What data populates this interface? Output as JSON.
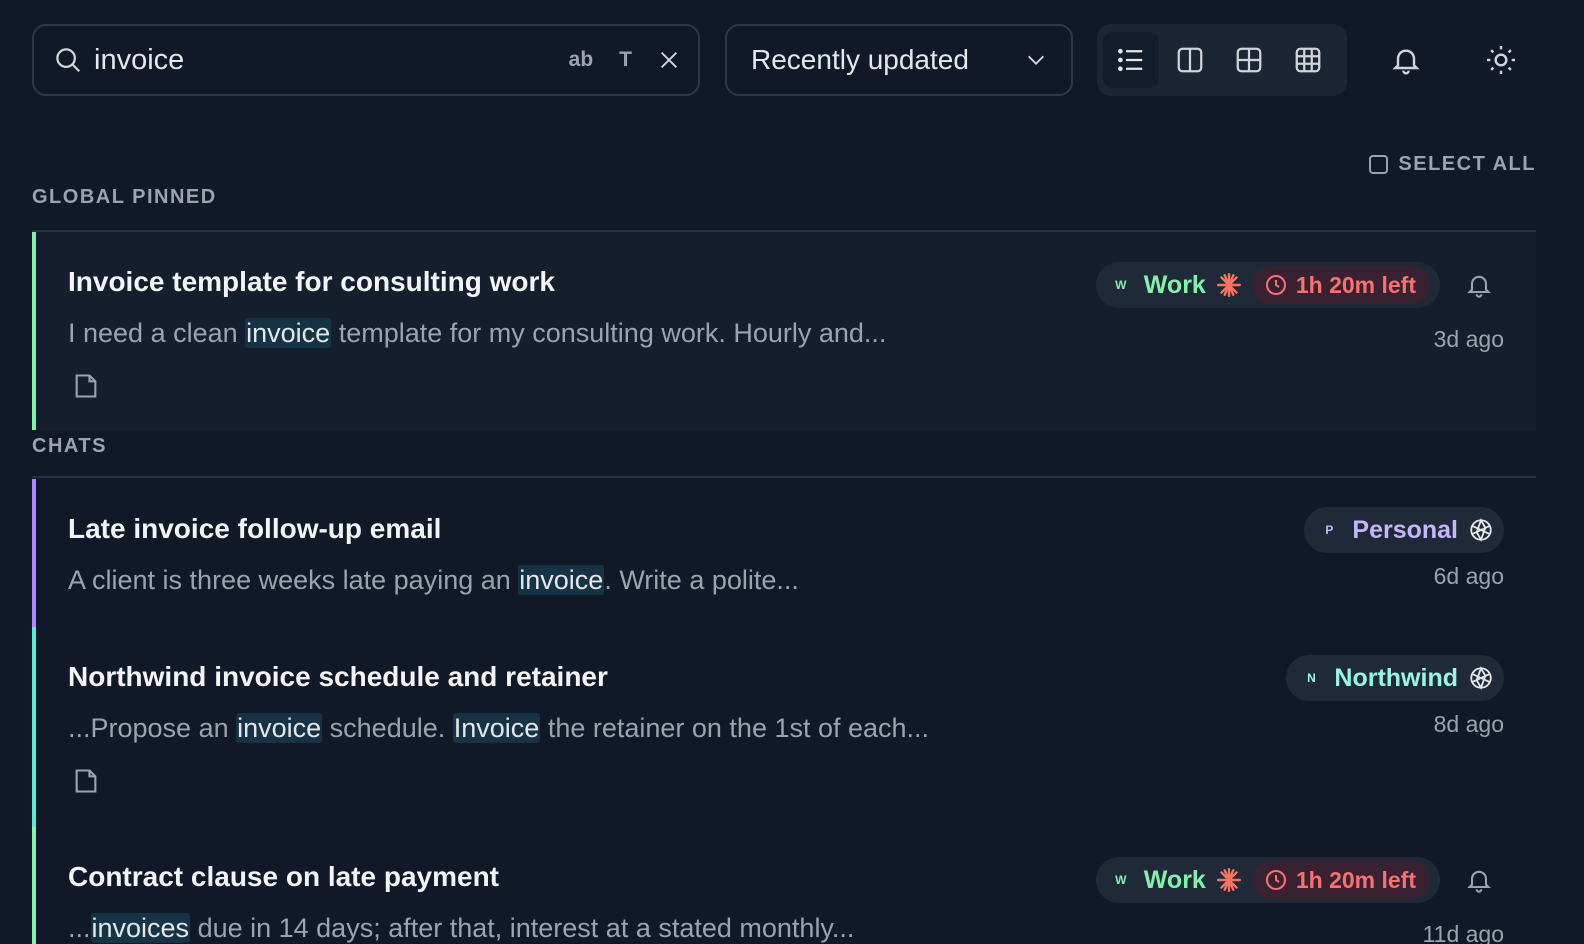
{
  "search": {
    "query": "invoice",
    "opt_word": "ab",
    "opt_case": "T"
  },
  "sort": {
    "selected": "Recently updated"
  },
  "select_all": "SELECT ALL",
  "sections": {
    "pinned": "GLOBAL PINNED",
    "chats": "CHATS"
  },
  "colors": {
    "work": "#86efac",
    "personal": "#c4b5fd",
    "northwind": "#99f6e4",
    "due": "#f87171",
    "highlight": "#163346"
  },
  "cards": [
    {
      "title": "Invoice template for consulting work",
      "snippet": [
        "I need a clean ",
        "invoice",
        " template for my consulting work. Hourly and..."
      ],
      "tag": {
        "initial": "W",
        "label": "Work",
        "provider_icon": "sparkle-icon"
      },
      "due": "1h 20m left",
      "time": "3d ago"
    },
    {
      "title": "Late invoice follow-up email",
      "snippet": [
        "A client is three weeks late paying an ",
        "invoice",
        ". Write a polite..."
      ],
      "tag": {
        "initial": "P",
        "label": "Personal",
        "provider_icon": "openai-icon"
      },
      "time": "6d ago"
    },
    {
      "title": "Northwind invoice schedule and retainer",
      "snippet": [
        "...Propose an ",
        "invoice",
        " schedule. ",
        "Invoice",
        " the retainer on the 1st of each..."
      ],
      "tag": {
        "initial": "N",
        "label": "Northwind",
        "provider_icon": "openai-icon"
      },
      "time": "8d ago"
    },
    {
      "title": "Contract clause on late payment",
      "snippet": [
        "...",
        "invoices",
        " due in 14 days; after that, interest at a stated monthly..."
      ],
      "tag": {
        "initial": "W",
        "label": "Work",
        "provider_icon": "sparkle-icon"
      },
      "due": "1h 20m left",
      "time": "11d ago"
    }
  ]
}
